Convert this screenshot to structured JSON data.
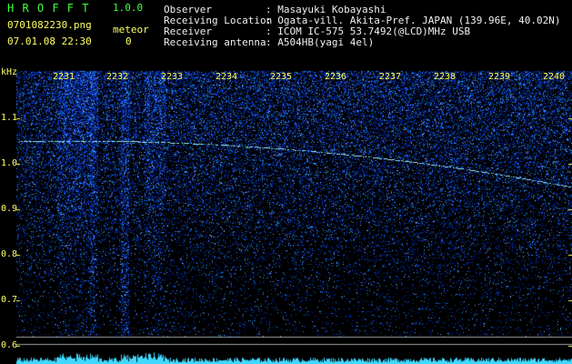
{
  "app": {
    "name": "H R O F F T",
    "version": "1.0.0"
  },
  "file": {
    "name": "0701082230.png",
    "datetime": "07.01.08 22:30"
  },
  "meteor": {
    "label": "meteor",
    "count": "0"
  },
  "info": [
    {
      "label": "Observer",
      "value": ": Masayuki Kobayashi"
    },
    {
      "label": "Receiving Location",
      "value": ": Ogata-vill. Akita-Pref. JAPAN (139.96E, 40.02N)"
    },
    {
      "label": "Receiver",
      "value": ": ICOM IC-575 53.7492(@LCD)MHz USB"
    },
    {
      "label": "Receiving antenna",
      "value": ": A504HB(yagi 4el)"
    }
  ],
  "axis": {
    "unit": "kHz",
    "y_ticks": [
      "1.1",
      "1.0",
      "0.9",
      "0.8",
      "0.7",
      "0.6"
    ],
    "x_ticks": [
      "2231",
      "2232",
      "2233",
      "2234",
      "2235",
      "2236",
      "2237",
      "2238",
      "2239",
      "2240"
    ]
  },
  "colors": {
    "background": "#000000",
    "label": "#ffff66",
    "title": "#40ff40",
    "noise": "#1a3cff",
    "trace": "#8fe8ff"
  }
}
